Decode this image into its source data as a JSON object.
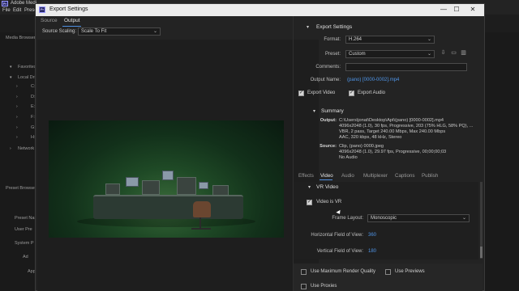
{
  "app": {
    "title": "Adobe Medi",
    "logo": "Pr",
    "menu": [
      "File",
      "Edit",
      "Prese"
    ],
    "media_browser_label": "Media Browser",
    "favorites_label": "Favorites",
    "local_drives_label": "Local Dri",
    "drives": [
      "C:",
      "D:",
      "E:",
      "F:",
      "G:",
      "H:"
    ],
    "network_label": "Network",
    "preset_browser_label": "Preset Browser",
    "preset_name_label": "Preset Nam",
    "user_presets_label": "User Pre",
    "system_presets_label": "System P",
    "au_label": "Ad",
    "app_label": "Appl"
  },
  "dialog": {
    "title": "Export Settings",
    "window_buttons": [
      "—",
      "☐",
      "✕"
    ],
    "tabs": [
      {
        "label": "Source"
      },
      {
        "label": "Output"
      }
    ],
    "source_scaling_label": "Source Scaling:",
    "source_scaling_value": "Scale To Fit"
  },
  "export_settings": {
    "header": "Export Settings",
    "format_label": "Format:",
    "format_value": "H.264",
    "preset_label": "Preset:",
    "preset_value": "Custom",
    "comments_label": "Comments:",
    "comments_value": "",
    "output_name_label": "Output Name:",
    "output_name_value": "(pano) [0000-0002].mp4",
    "export_video_label": "Export Video",
    "export_audio_label": "Export Audio",
    "export_video_checked": true,
    "export_audio_checked": true
  },
  "summary": {
    "header": "Summary",
    "output_label": "Output:",
    "output_lines": [
      "C:\\Users\\jonat\\Desktop\\Apt\\(pano) [0000-0002].mp4",
      "4096x2048 (1.0), 30 fps, Progressive, 203 (75% HLG, 58% PQ), ...",
      "VBR, 2 pass, Target 240.00 Mbps, Max 240.00 Mbps",
      "AAC, 320 kbps, 48 kHz, Stereo"
    ],
    "source_label": "Source:",
    "source_lines": [
      "Clip, (pano) 0000.jpeg",
      "4096x2048 (1.0), 29.97 fps, Progressive, 00;00;00;03",
      "No Audio"
    ]
  },
  "subtabs": [
    {
      "label": "Effects"
    },
    {
      "label": "Video"
    },
    {
      "label": "Audio"
    },
    {
      "label": "Multiplexer"
    },
    {
      "label": "Captions"
    },
    {
      "label": "Publish"
    }
  ],
  "vr": {
    "header": "VR Video",
    "video_is_vr_label": "Video is VR",
    "video_is_vr_checked": true,
    "frame_layout_label": "Frame Layout:",
    "frame_layout_value": "Monoscopic",
    "h_fov_label": "Horizontal Field of View:",
    "h_fov_value": "360",
    "v_fov_label": "Vertical Field of View:",
    "v_fov_value": "180"
  },
  "bottom": {
    "max_render_label": "Use Maximum Render Quality",
    "use_previews_label": "Use Previews",
    "use_proxies_label": "Use Proxies"
  },
  "colors": {
    "accent": "#4f95e8",
    "titlebar": "#ebebeb"
  }
}
